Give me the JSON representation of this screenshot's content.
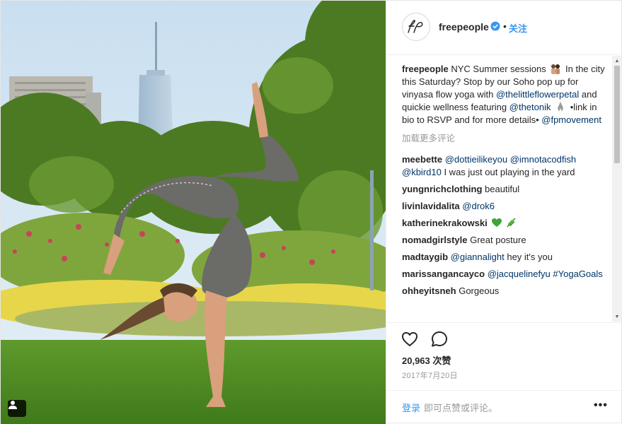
{
  "header": {
    "username": "freepeople",
    "verified_icon": "verified-badge-icon",
    "separator": "•",
    "follow_label": "关注"
  },
  "caption": {
    "username": "freepeople",
    "text_1": "NYC Summer sessions",
    "text_2": "In the city this Saturday? Stop by our Soho pop up for vinyasa flow yoga with",
    "mention_1": "@thelittleflowerpetal",
    "text_3": "and quickie wellness featuring",
    "mention_2": "@thetonik",
    "text_4": "•link in bio to RSVP and for more details•",
    "mention_3": "@fpmovement"
  },
  "load_more": "加载更多评论",
  "comments": [
    {
      "user": "meebette",
      "parts": [
        {
          "t": "@dottieilikeyou",
          "m": true
        },
        {
          "t": " ",
          "m": false
        },
        {
          "t": "@imnotacodfish",
          "m": true
        },
        {
          "t": " ",
          "m": false
        },
        {
          "t": "@kbird10",
          "m": true
        },
        {
          "t": " I was just out playing in the yard",
          "m": false
        }
      ]
    },
    {
      "user": "yungnrichclothing",
      "parts": [
        {
          "t": "beautiful",
          "m": false
        }
      ]
    },
    {
      "user": "livinlavidalita",
      "parts": [
        {
          "t": "@drok6",
          "m": true
        }
      ]
    },
    {
      "user": "katherinekrakowski",
      "parts": [],
      "emoji": [
        "green-heart-icon",
        "herb-icon"
      ]
    },
    {
      "user": "nomadgirlstyle",
      "parts": [
        {
          "t": "Great posture",
          "m": false
        }
      ]
    },
    {
      "user": "madtaygib",
      "parts": [
        {
          "t": "@giannalight",
          "m": true
        },
        {
          "t": " hey it's you",
          "m": false
        }
      ]
    },
    {
      "user": "marissangancayco",
      "parts": [
        {
          "t": "@jacquelinefyu",
          "m": true
        },
        {
          "t": " ",
          "m": false
        },
        {
          "t": "#YogaGoals",
          "m": true
        }
      ]
    },
    {
      "user": "ohheyitsneh",
      "parts": [
        {
          "t": "Gorgeous",
          "m": false
        }
      ]
    }
  ],
  "actions": {
    "likes": "20,963 次赞",
    "date": "2017年7月20日"
  },
  "footer": {
    "login": "登录",
    "login_rest": "即可点赞或评论。",
    "more": "•••"
  },
  "colors": {
    "link": "#3897f0",
    "mention": "#003569",
    "muted": "#999999",
    "text": "#262626"
  }
}
